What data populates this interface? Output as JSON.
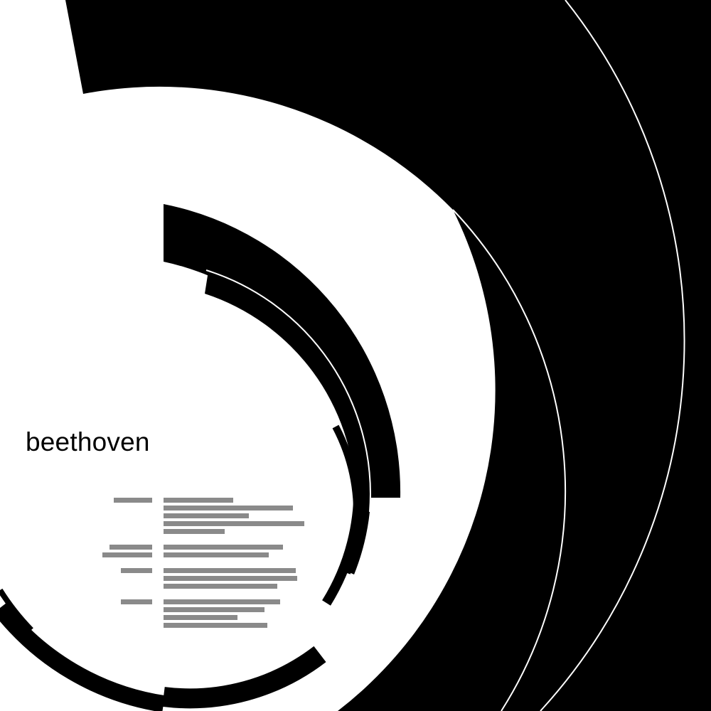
{
  "title": "beethoven",
  "colors": {
    "background": "#ffffff",
    "foreground": "#000000",
    "placeholder": "#8a8a8a"
  }
}
